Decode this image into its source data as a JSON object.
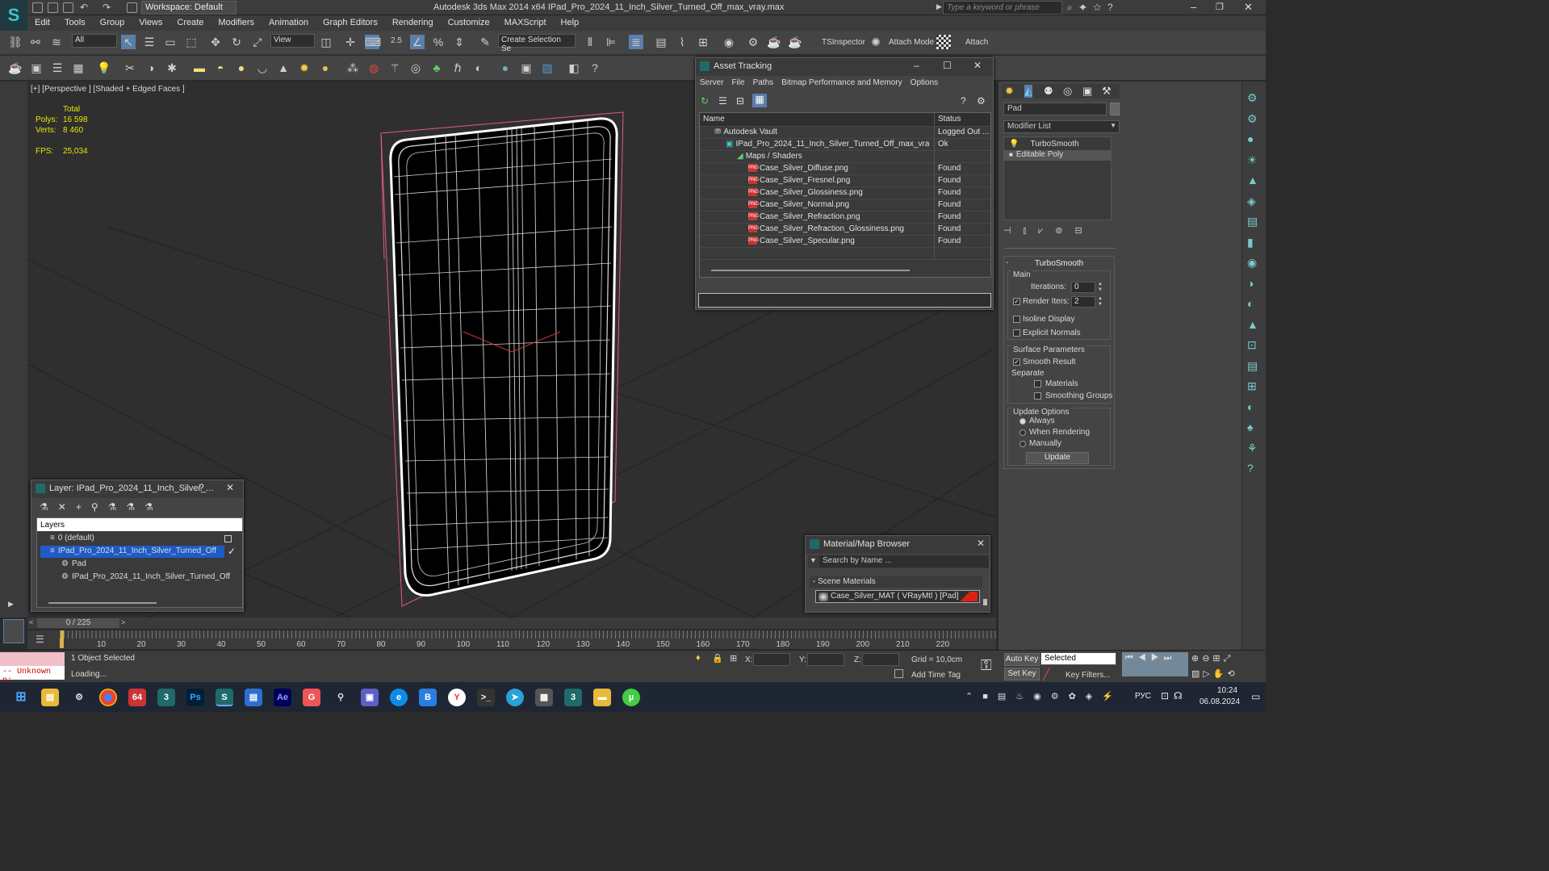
{
  "titlebar": {
    "workspace": "Workspace: Default",
    "app_title": "Autodesk 3ds Max 2014 x64     IPad_Pro_2024_11_Inch_Silver_Turned_Off_max_vray.max",
    "search_placeholder": "Type a keyword or phrase"
  },
  "menu": [
    "Edit",
    "Tools",
    "Group",
    "Views",
    "Create",
    "Modifiers",
    "Animation",
    "Graph Editors",
    "Rendering",
    "Customize",
    "MAXScript",
    "Help"
  ],
  "toolbar": {
    "selection_filter": "All",
    "ref_coord": "View",
    "angle_snap": "2.5",
    "named_selection": "Create Selection Se",
    "tsinspector": "TSInspector",
    "attach_mode": "Attach Mode",
    "attach": "Attach"
  },
  "viewport": {
    "label": "[+] [Perspective ] [Shaded + Edged Faces ]",
    "stats_header": "Total",
    "polys_label": "Polys:",
    "polys": "16 598",
    "verts_label": "Verts:",
    "verts": "8 460",
    "fps_label": "FPS:",
    "fps": "25,034"
  },
  "asset_tracking": {
    "title": "Asset Tracking",
    "menu": [
      "Server",
      "File",
      "Paths",
      "Bitmap Performance and Memory",
      "Options"
    ],
    "col_name": "Name",
    "col_status": "Status",
    "rows": [
      {
        "name": "Autodesk Vault",
        "status": "Logged Out ..."
      },
      {
        "name": "IPad_Pro_2024_11_Inch_Silver_Turned_Off_max_vray....",
        "status": "Ok"
      },
      {
        "name": "Maps / Shaders",
        "status": ""
      },
      {
        "name": "Case_Silver_Diffuse.png",
        "status": "Found"
      },
      {
        "name": "Case_Silver_Fresnel.png",
        "status": "Found"
      },
      {
        "name": "Case_Silver_Glossiness.png",
        "status": "Found"
      },
      {
        "name": "Case_Silver_Normal.png",
        "status": "Found"
      },
      {
        "name": "Case_Silver_Refraction.png",
        "status": "Found"
      },
      {
        "name": "Case_Silver_Refraction_Glossiness.png",
        "status": "Found"
      },
      {
        "name": "Case_Silver_Specular.png",
        "status": "Found"
      }
    ]
  },
  "command_panel": {
    "object_name": "Pad",
    "modifier_list": "Modifier List",
    "stack": [
      "TurboSmooth",
      "Editable Poly"
    ],
    "rollout_title": "TurboSmooth",
    "main_label": "Main",
    "iterations_label": "Iterations:",
    "iterations": "0",
    "render_iters_label": "Render Iters:",
    "render_iters": "2",
    "isoline": "Isoline Display",
    "explicit_normals": "Explicit Normals",
    "surface_params": "Surface Parameters",
    "smooth_result": "Smooth Result",
    "separate": "Separate",
    "materials": "Materials",
    "smoothing_groups": "Smoothing Groups",
    "update_options": "Update Options",
    "always": "Always",
    "when_rendering": "When Rendering",
    "manually": "Manually",
    "update_btn": "Update"
  },
  "layer_window": {
    "title": "Layer: IPad_Pro_2024_11_Inch_Silver_...",
    "help": "?",
    "header": "Layers",
    "items": [
      {
        "label": "0 (default)"
      },
      {
        "label": "IPad_Pro_2024_11_Inch_Silver_Turned_Off"
      },
      {
        "label": "Pad"
      },
      {
        "label": "IPad_Pro_2024_11_Inch_Silver_Turned_Off"
      }
    ]
  },
  "material_browser": {
    "title": "Material/Map Browser",
    "search_placeholder": "Search by Name ...",
    "section": "- Scene Materials",
    "item": "Case_Silver_MAT ( VRayMtl ) [Pad]"
  },
  "timeline": {
    "frame": "0 / 225",
    "ticks": [
      "10",
      "20",
      "30",
      "40",
      "50",
      "60",
      "70",
      "80",
      "90",
      "100",
      "110",
      "120",
      "130",
      "140",
      "150",
      "160",
      "170",
      "180",
      "190",
      "200",
      "210",
      "220"
    ]
  },
  "status": {
    "script": "-- Unknown p:",
    "selected": "1 Object Selected",
    "loading": "Loading...",
    "x_label": "X:",
    "y_label": "Y:",
    "z_label": "Z:",
    "grid": "Grid = 10,0cm",
    "add_time_tag": "Add Time Tag",
    "auto_key": "Auto Key",
    "set_key": "Set Key",
    "selected_dd": "Selected",
    "key_filters": "Key Filters..."
  },
  "taskbar": {
    "lang": "РУС",
    "time": "10:24",
    "date": "06.08.2024"
  }
}
